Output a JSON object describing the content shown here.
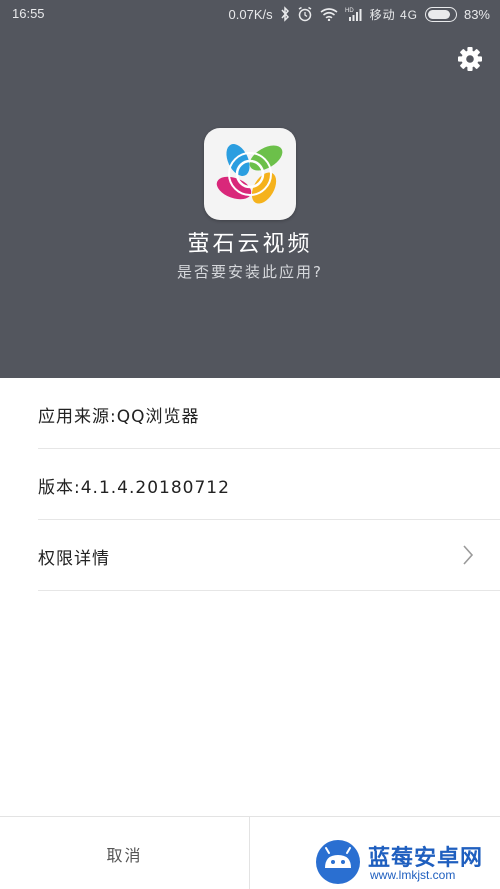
{
  "status_bar": {
    "time": "16:55",
    "speed": "0.07K/s",
    "carrier": "移动 4G",
    "battery_level": 0.83,
    "battery_percent": "83%",
    "icons": [
      "bluetooth-icon",
      "alarm-icon",
      "wifi-icon",
      "hd-signal-icon",
      "battery-icon"
    ]
  },
  "header": {
    "background": "#53565e",
    "settings_icon": "gear-icon",
    "app_name": "萤石云视频",
    "question": "是否要安装此应用?"
  },
  "info": {
    "source": "应用来源:QQ浏览器",
    "version": "版本:4.1.4.20180712",
    "permissions": "权限详情",
    "permissions_icon": "chevron-right-icon"
  },
  "actions": {
    "cancel": "取消"
  },
  "watermark": {
    "title": "蓝莓安卓网",
    "url": "www.lmkjst.com"
  }
}
